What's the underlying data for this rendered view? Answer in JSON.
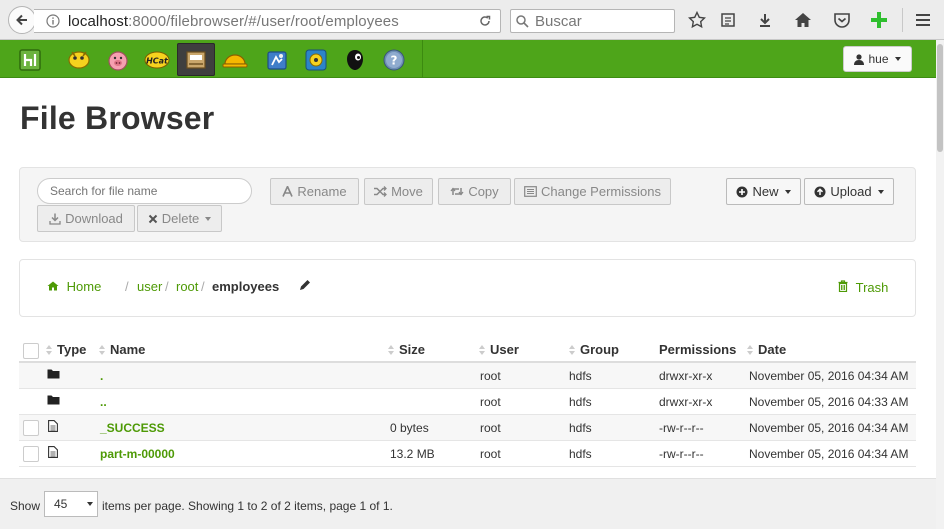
{
  "browser": {
    "url_host": "localhost",
    "url_rest": ":8000/filebrowser/#/user/root/employees",
    "search_placeholder": "Buscar"
  },
  "hue": {
    "apps": [
      "hue-logo-icon",
      "hive-icon",
      "pig-icon",
      "hcat-icon",
      "filebrowser-icon",
      "jobbrowser-icon",
      "oozie-icon",
      "beeswax-icon",
      "sqoop-icon",
      "help-icon"
    ],
    "user_label": "hue"
  },
  "page": {
    "title": "File Browser"
  },
  "actions": {
    "search_placeholder": "Search for file name",
    "rename": "Rename",
    "move": "Move",
    "copy": "Copy",
    "change_permissions": "Change Permissions",
    "download": "Download",
    "delete": "Delete",
    "new": "New",
    "upload": "Upload"
  },
  "breadcrumb": {
    "home": "Home",
    "user": "user",
    "sep": "/",
    "root": "root",
    "current": "employees",
    "trash": "Trash"
  },
  "table": {
    "headers": {
      "type": "Type",
      "name": "Name",
      "size": "Size",
      "user": "User",
      "group": "Group",
      "permissions": "Permissions",
      "date": "Date"
    },
    "rows": [
      {
        "kind": "folder",
        "name": ".",
        "size": "",
        "user": "root",
        "group": "hdfs",
        "perms": "drwxr-xr-x",
        "date": "November 05, 2016 04:34 AM"
      },
      {
        "kind": "folder",
        "name": "..",
        "size": "",
        "user": "root",
        "group": "hdfs",
        "perms": "drwxr-xr-x",
        "date": "November 05, 2016 04:33 AM"
      },
      {
        "kind": "file",
        "name": "_SUCCESS",
        "size": "0 bytes",
        "user": "root",
        "group": "hdfs",
        "perms": "-rw-r--r--",
        "date": "November 05, 2016 04:34 AM"
      },
      {
        "kind": "file",
        "name": "part-m-00000",
        "size": "13.2 MB",
        "user": "root",
        "group": "hdfs",
        "perms": "-rw-r--r--",
        "date": "November 05, 2016 04:34 AM"
      }
    ]
  },
  "footer": {
    "show": "Show",
    "per_page": "45",
    "info": "items per page. Showing 1 to 2 of 2 items, page 1 of 1."
  },
  "colors": {
    "hue_green": "#4ea51a",
    "link_green": "#4e9a06"
  }
}
